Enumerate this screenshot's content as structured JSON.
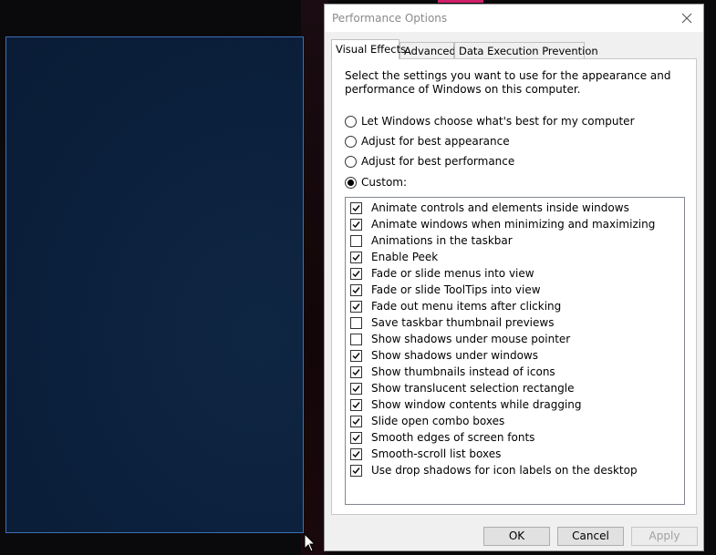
{
  "dialog": {
    "title": "Performance Options"
  },
  "tabs": [
    {
      "label": "Visual Effects",
      "active": true
    },
    {
      "label": "Advanced",
      "active": false
    },
    {
      "label": "Data Execution Prevention",
      "active": false
    }
  ],
  "intro_text": "Select the settings you want to use for the appearance and performance of Windows on this computer.",
  "radios": [
    {
      "label": "Let Windows choose what's best for my computer",
      "checked": false
    },
    {
      "label": "Adjust for best appearance",
      "checked": false
    },
    {
      "label": "Adjust for best performance",
      "checked": false
    },
    {
      "label": "Custom:",
      "checked": true
    }
  ],
  "effects": [
    {
      "label": "Animate controls and elements inside windows",
      "checked": true
    },
    {
      "label": "Animate windows when minimizing and maximizing",
      "checked": true
    },
    {
      "label": "Animations in the taskbar",
      "checked": false
    },
    {
      "label": "Enable Peek",
      "checked": true
    },
    {
      "label": "Fade or slide menus into view",
      "checked": true
    },
    {
      "label": "Fade or slide ToolTips into view",
      "checked": true
    },
    {
      "label": "Fade out menu items after clicking",
      "checked": true
    },
    {
      "label": "Save taskbar thumbnail previews",
      "checked": false
    },
    {
      "label": "Show shadows under mouse pointer",
      "checked": false
    },
    {
      "label": "Show shadows under windows",
      "checked": true
    },
    {
      "label": "Show thumbnails instead of icons",
      "checked": true
    },
    {
      "label": "Show translucent selection rectangle",
      "checked": true
    },
    {
      "label": "Show window contents while dragging",
      "checked": true
    },
    {
      "label": "Slide open combo boxes",
      "checked": true
    },
    {
      "label": "Smooth edges of screen fonts",
      "checked": true
    },
    {
      "label": "Smooth-scroll list boxes",
      "checked": true
    },
    {
      "label": "Use drop shadows for icon labels on the desktop",
      "checked": true
    }
  ],
  "buttons": {
    "ok": {
      "label": "OK",
      "enabled": true
    },
    "cancel": {
      "label": "Cancel",
      "enabled": true
    },
    "apply": {
      "label": "Apply",
      "enabled": false
    }
  }
}
